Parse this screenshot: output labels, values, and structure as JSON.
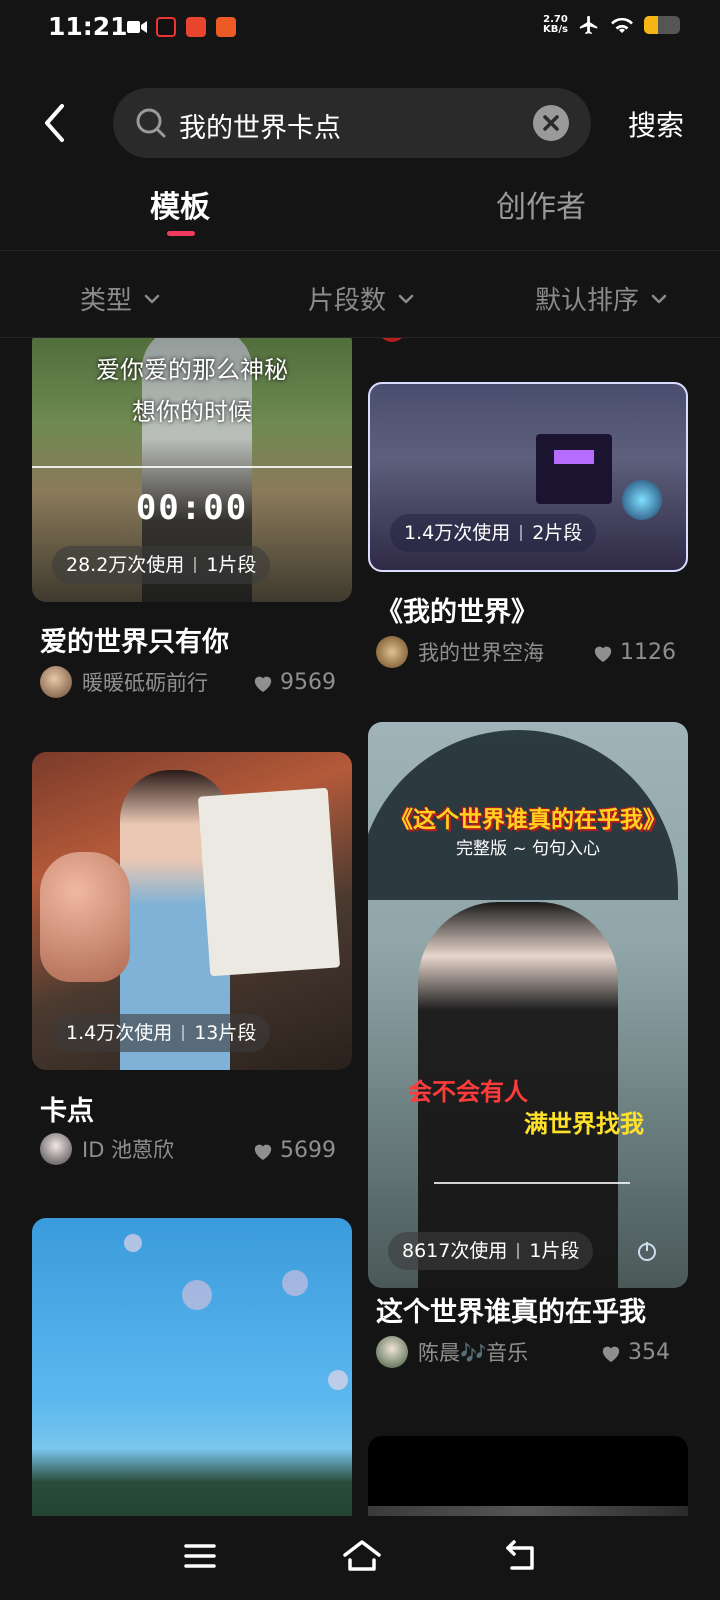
{
  "status_bar": {
    "time": "11:21",
    "net_speed_value": "2.70",
    "net_speed_unit": "KB/s",
    "battery_level": 0.4
  },
  "search": {
    "query": "我的世界卡点",
    "submit_label": "搜索"
  },
  "tabs": [
    {
      "label": "模板",
      "active": true
    },
    {
      "label": "创作者",
      "active": false
    }
  ],
  "filters": [
    {
      "label": "类型"
    },
    {
      "label": "片段数"
    },
    {
      "label": "默认排序"
    }
  ],
  "cards": {
    "left": [
      {
        "stats_uses": "28.2万次使用",
        "stats_segments": "1片段",
        "title": "爱的世界只有你",
        "author": "暖暖砥砺前行",
        "likes": "9569",
        "lyrics": [
          "爱你爱的那么神秘",
          "想你的时候"
        ],
        "time_display": "00:00"
      },
      {
        "stats_uses": "1.4万次使用",
        "stats_segments": "13片段",
        "title": "卡点",
        "author": "ID 池蒽欣",
        "likes": "5699"
      },
      {}
    ],
    "right": [
      {
        "stats_uses": "1.4万次使用",
        "stats_segments": "2片段",
        "title": "《我的世界》",
        "author": "我的世界空海",
        "likes": "1126"
      },
      {
        "stats_uses": "8617次使用",
        "stats_segments": "1片段",
        "title": "这个世界谁真的在乎我",
        "author": "陈晨🎶音乐",
        "likes": "354",
        "poster_title": "《这个世界谁真的在乎我》",
        "poster_sub": "完整版 ~ 句句入心",
        "poster_line1": "会不会有人",
        "poster_line2": "满世界找我"
      }
    ]
  },
  "icons": [
    "back-icon",
    "search-icon",
    "clear-icon",
    "chevron-down-icon",
    "heart-icon",
    "menu-icon",
    "home-icon",
    "back-nav-icon"
  ],
  "colors": {
    "accent": "#f23a5e",
    "background": "#141414",
    "search_bg": "#2a2a2a"
  }
}
